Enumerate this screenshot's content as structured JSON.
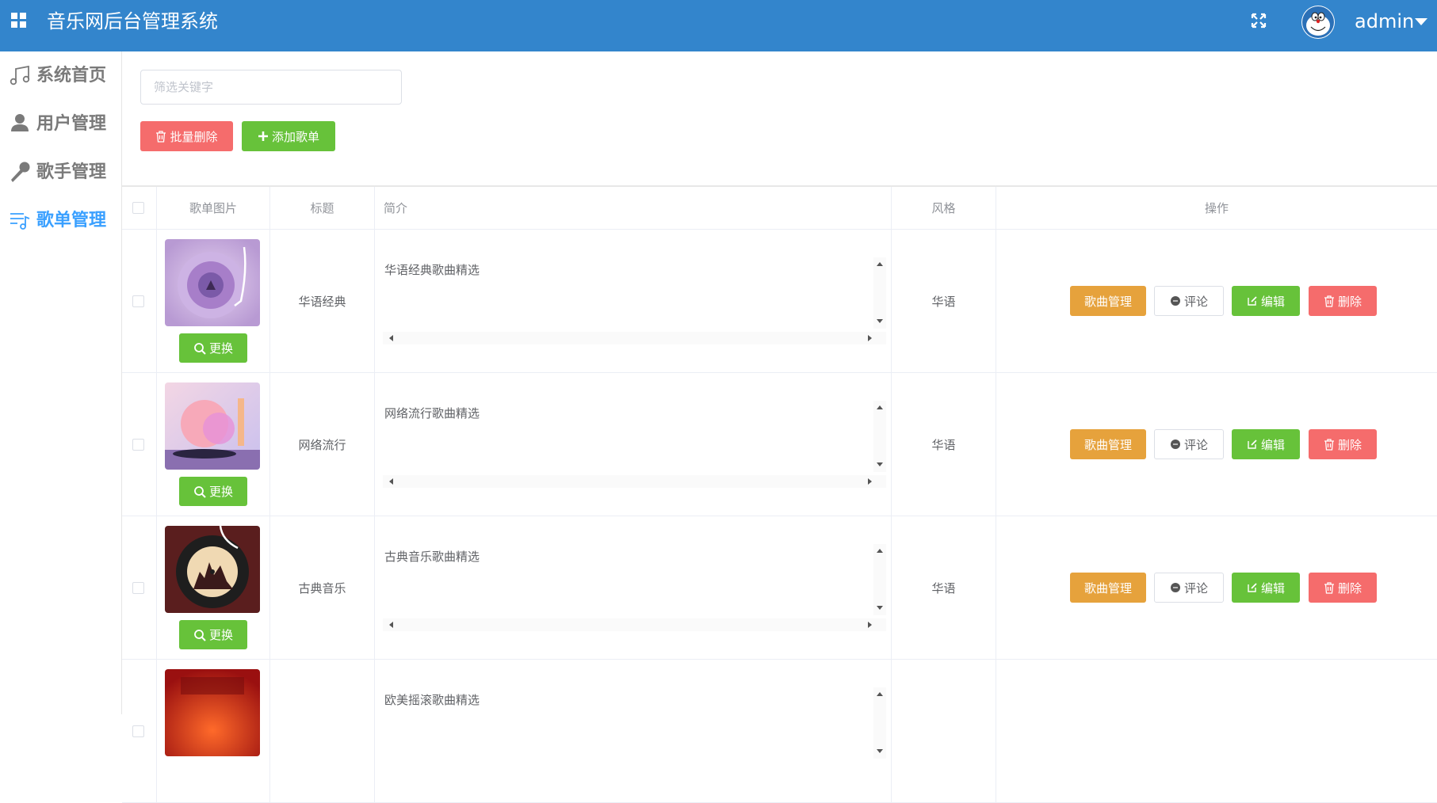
{
  "header": {
    "title": "音乐网后台管理系统",
    "username": "admin"
  },
  "sidebar": {
    "items": [
      {
        "label": "系统首页",
        "icon": "music-note-icon",
        "active": false
      },
      {
        "label": "用户管理",
        "icon": "user-icon",
        "active": false
      },
      {
        "label": "歌手管理",
        "icon": "microphone-icon",
        "active": false
      },
      {
        "label": "歌单管理",
        "icon": "playlist-icon",
        "active": true
      }
    ]
  },
  "filter": {
    "placeholder": "筛选关键字",
    "value": ""
  },
  "toolbar": {
    "batch_delete_label": "批量删除",
    "add_label": "添加歌单"
  },
  "table": {
    "headers": {
      "image": "歌单图片",
      "title": "标题",
      "intro": "简介",
      "style": "风格",
      "actions": "操作"
    },
    "change_label": "更换",
    "actions": {
      "songs": "歌曲管理",
      "comment": "评论",
      "edit": "编辑",
      "delete": "删除"
    },
    "rows": [
      {
        "title": "华语经典",
        "intro": "华语经典歌曲精选",
        "style": "华语"
      },
      {
        "title": "网络流行",
        "intro": "网络流行歌曲精选",
        "style": "华语"
      },
      {
        "title": "古典音乐",
        "intro": "古典音乐歌曲精选",
        "style": "华语"
      },
      {
        "title": "",
        "intro": "欧美摇滚歌曲精选",
        "style": ""
      }
    ]
  },
  "colors": {
    "header_bg": "#3385cc",
    "active": "#3aa0ff",
    "danger": "#f56c6c",
    "success": "#67c23a",
    "warning": "#e6a23c"
  }
}
